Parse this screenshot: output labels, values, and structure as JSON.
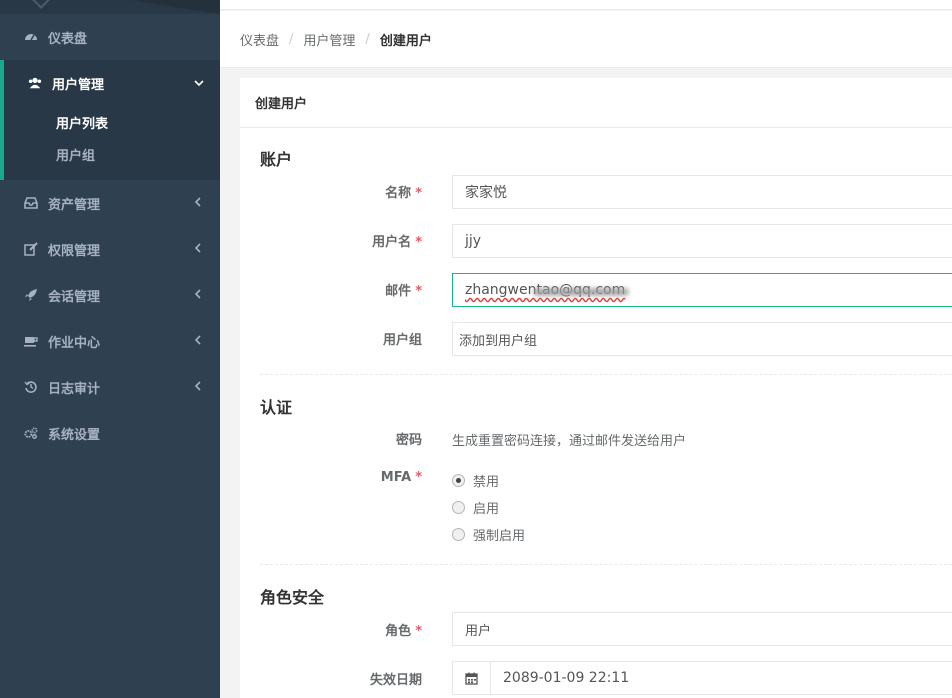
{
  "sidebar": {
    "items": [
      {
        "label": "仪表盘",
        "icon": "dashboard-icon"
      },
      {
        "label": "用户管理",
        "icon": "users-icon",
        "expanded": true,
        "children": [
          {
            "label": "用户列表",
            "active": true
          },
          {
            "label": "用户组"
          }
        ]
      },
      {
        "label": "资产管理",
        "icon": "inbox-icon"
      },
      {
        "label": "权限管理",
        "icon": "edit-icon"
      },
      {
        "label": "会话管理",
        "icon": "rocket-icon"
      },
      {
        "label": "作业中心",
        "icon": "coffee-icon"
      },
      {
        "label": "日志审计",
        "icon": "history-icon"
      },
      {
        "label": "系统设置",
        "icon": "gears-icon"
      }
    ]
  },
  "breadcrumb": [
    "仪表盘",
    "用户管理",
    "创建用户"
  ],
  "panel": {
    "title": "创建用户",
    "account": {
      "title": "账户",
      "name_label": "名称",
      "name_value": "家家悦",
      "username_label": "用户名",
      "username_value": "jjy",
      "email_label": "邮件",
      "email_value": "zhangwentao@qq.com",
      "group_label": "用户组",
      "group_placeholder": "添加到用户组"
    },
    "auth": {
      "title": "认证",
      "password_label": "密码",
      "password_text": "生成重置密码连接，通过邮件发送给用户",
      "mfa_label": "MFA",
      "mfa_options": [
        "禁用",
        "启用",
        "强制启用"
      ],
      "mfa_selected": "禁用"
    },
    "role_security": {
      "title": "角色安全",
      "role_label": "角色",
      "role_value": "用户",
      "expire_label": "失效日期",
      "expire_value": "2089-01-09 22:11"
    }
  },
  "colors": {
    "sidebar_bg": "#2f4050",
    "accent": "#19aa8d",
    "required": "#ed5565"
  }
}
